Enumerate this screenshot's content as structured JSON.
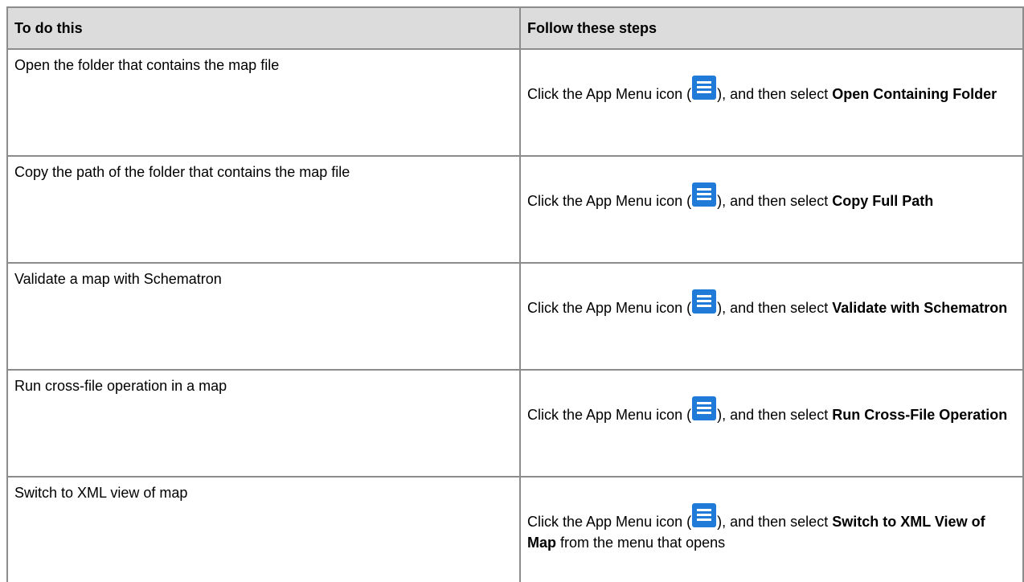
{
  "table": {
    "headers": [
      "To do this",
      "Follow these steps"
    ],
    "icon": "app-menu-icon",
    "icon_color": "#1f7ad8",
    "header_background": "#dcdcdc",
    "border_color": "#8c8c8c",
    "rows": [
      {
        "task": "Open the folder that contains the map file",
        "step_prefix": "Click the App Menu icon (",
        "step_middle": "), and then select ",
        "step_bold": "Open Containing Folder",
        "step_suffix": ""
      },
      {
        "task": "Copy the path of the folder that contains the map file",
        "step_prefix": "Click the App Menu icon (",
        "step_middle": "), and then select ",
        "step_bold": "Copy Full Path",
        "step_suffix": ""
      },
      {
        "task": "Validate a map with Schematron",
        "step_prefix": "Click the App Menu icon (",
        "step_middle": "), and then select ",
        "step_bold": "Validate with Schematron",
        "step_suffix": ""
      },
      {
        "task": "Run cross-file operation in a map",
        "step_prefix": "Click the App Menu icon (",
        "step_middle": "), and then select ",
        "step_bold": "Run Cross-File Operation",
        "step_suffix": ""
      },
      {
        "task": "Switch to XML view of map",
        "step_prefix": "Click the App Menu icon (",
        "step_middle": "), and then select ",
        "step_bold": "Switch to XML View of Map",
        "step_suffix": " from the menu that opens"
      }
    ]
  }
}
